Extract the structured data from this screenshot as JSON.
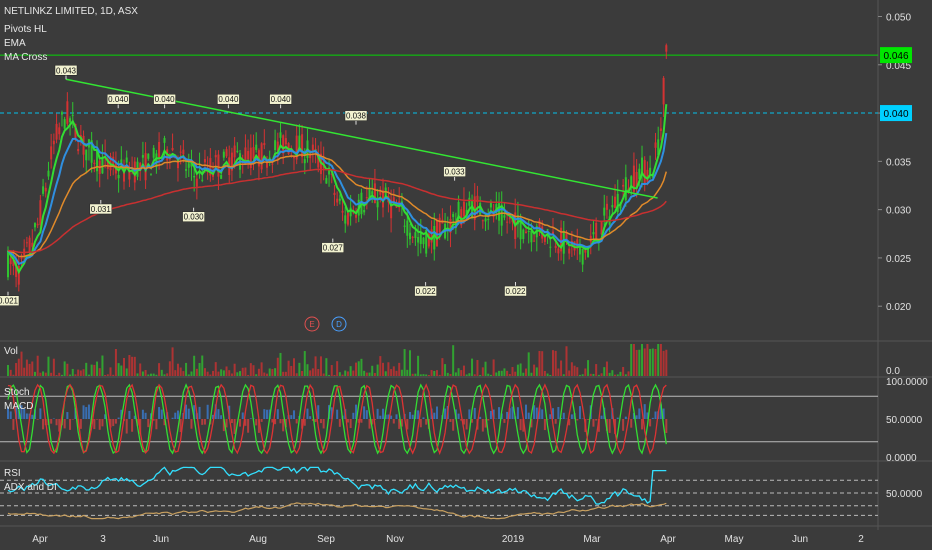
{
  "header": {
    "symbol_line": "NETLINKZ LIMITED, 1D, ASX",
    "indicators": [
      "Pivots HL",
      "EMA",
      "MA Cross"
    ]
  },
  "chart_data": {
    "type": "candlestick",
    "price_axis": {
      "ticks": [
        "0.050",
        "0.045",
        "0.040",
        "0.035",
        "0.030",
        "0.025",
        "0.020"
      ],
      "range": [
        0.0165,
        0.0515
      ]
    },
    "price_badges": [
      {
        "value": "0.046",
        "color": "#00e600"
      },
      {
        "value": "0.040",
        "color": "#00d0ff"
      }
    ],
    "x_axis_labels": [
      "Apr",
      "3",
      "Jun",
      "Aug",
      "Sep",
      "Nov",
      "2019",
      "Mar",
      "Apr",
      "May",
      "Jun",
      "2"
    ],
    "pivot_labels": [
      {
        "text": "0.043",
        "type": "high",
        "price": 0.0435,
        "t": 0.1
      },
      {
        "text": "0.040",
        "type": "high",
        "price": 0.0405,
        "t": 0.19
      },
      {
        "text": "0.040",
        "type": "high",
        "price": 0.0405,
        "t": 0.27
      },
      {
        "text": "0.040",
        "type": "high",
        "price": 0.0405,
        "t": 0.38
      },
      {
        "text": "0.040",
        "type": "high",
        "price": 0.0405,
        "t": 0.47
      },
      {
        "text": "0.038",
        "type": "high",
        "price": 0.0388,
        "t": 0.6
      },
      {
        "text": "0.033",
        "type": "high",
        "price": 0.033,
        "t": 0.77
      },
      {
        "text": "0.031",
        "type": "low",
        "price": 0.031,
        "t": 0.16
      },
      {
        "text": "0.030",
        "type": "low",
        "price": 0.0302,
        "t": 0.32
      },
      {
        "text": "0.027",
        "type": "low",
        "price": 0.027,
        "t": 0.56
      },
      {
        "text": "0.022",
        "type": "low",
        "price": 0.0225,
        "t": 0.72
      },
      {
        "text": "0.022",
        "type": "low",
        "price": 0.0225,
        "t": 0.875
      },
      {
        "text": "0.021",
        "type": "low",
        "price": 0.0215,
        "t": 0.0
      }
    ],
    "trendline": {
      "from": {
        "t": 0.1,
        "price": 0.0435
      },
      "to": {
        "t": 1.12,
        "price": 0.0312
      },
      "color": "#33e633"
    },
    "horizontal_lines": [
      {
        "price": 0.046,
        "style": "solid",
        "color": "#00e600"
      },
      {
        "price": 0.04,
        "style": "dashed",
        "color": "#00d0ff"
      }
    ],
    "markers": [
      "E",
      "D"
    ],
    "volume_axis": [
      "0.0"
    ],
    "stoch_macd_axis": [
      "100.0000",
      "50.0000",
      "0.0000"
    ],
    "rsi_adx_axis": [
      "50.0000"
    ],
    "panel_titles": {
      "volume": "Vol",
      "stoch": "Stoch",
      "macd": "MACD",
      "rsi": "RSI",
      "adx": "ADX and DI"
    }
  },
  "colors": {
    "background": "#3b3b3b",
    "up": "#2fc52f",
    "down": "#d43232",
    "ema_fast": "#33dd33",
    "ema_mid": "#2f8fe0",
    "ema_slow": "#e08a2a",
    "ma_long": "#c83030",
    "rsi": "#33e0ff",
    "adx": "#c8a060",
    "stoch_k": "#33dd33",
    "stoch_d": "#dd3333",
    "macd_hist": "#3a78c8"
  }
}
